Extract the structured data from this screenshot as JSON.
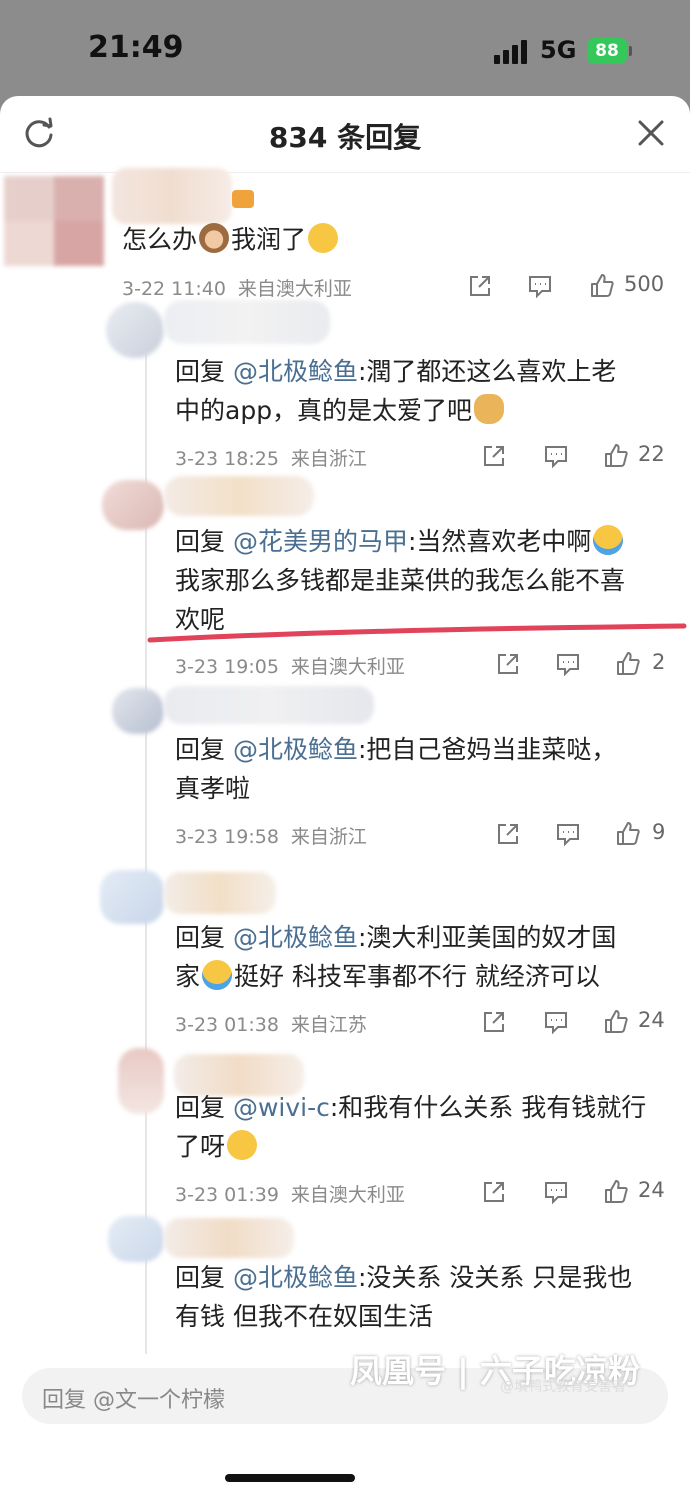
{
  "status_bar": {
    "time": "21:49",
    "network": "5G",
    "battery": "88"
  },
  "header": {
    "title": "834 条回复"
  },
  "comment": {
    "text_before": "怎么办",
    "text_after": "我润了",
    "date": "3-22 11:40",
    "location": "来自澳大利亚",
    "likes": "500"
  },
  "replies": [
    {
      "prefix": "回复 ",
      "mention": "@北极鲶鱼",
      "line1": ":潤了都还这么喜欢上老",
      "line2": "中的app，真的是太爱了吧",
      "date": "3-23 18:25",
      "location": "来自浙江",
      "likes": "22"
    },
    {
      "prefix": "回复 ",
      "mention": "@花美男的马甲",
      "line1": ":当然喜欢老中啊",
      "line2": "我家那么多钱都是韭菜供的我怎么能不喜",
      "line3": "欢呢",
      "date": "3-23 19:05",
      "location": "来自澳大利亚",
      "likes": "2"
    },
    {
      "prefix": "回复 ",
      "mention": "@北极鲶鱼",
      "line1": ":把自己爸妈当韭菜哒，",
      "line2": "真孝啦",
      "date": "3-23 19:58",
      "location": "来自浙江",
      "likes": "9"
    },
    {
      "prefix": "回复 ",
      "mention": "@北极鲶鱼",
      "line1": ":澳大利亚美国的奴才国",
      "line2a": "家",
      "line2b": "挺好 科技军事都不行 就经济可以",
      "date": "3-23 01:38",
      "location": "来自江苏",
      "likes": "24"
    },
    {
      "prefix": "回复 ",
      "mention": "@wivi-c",
      "line1": ":和我有什么关系 我有钱就行",
      "line2": "了呀",
      "date": "3-23 01:39",
      "location": "来自澳大利亚",
      "likes": "24"
    },
    {
      "prefix": "回复 ",
      "mention": "@北极鲶鱼",
      "line1": ":没关系 没关系 只是我也",
      "line2": "有钱 但我不在奴国生活"
    }
  ],
  "input": {
    "placeholder": "回复 @文一个柠檬"
  },
  "watermark": {
    "main": "凤凰号 | 六子吃凉粉",
    "sub": "@填鸭式教育受害者"
  },
  "colors": {
    "mention": "#4a6f92",
    "underline": "#e0435a",
    "battery": "#34c759"
  }
}
